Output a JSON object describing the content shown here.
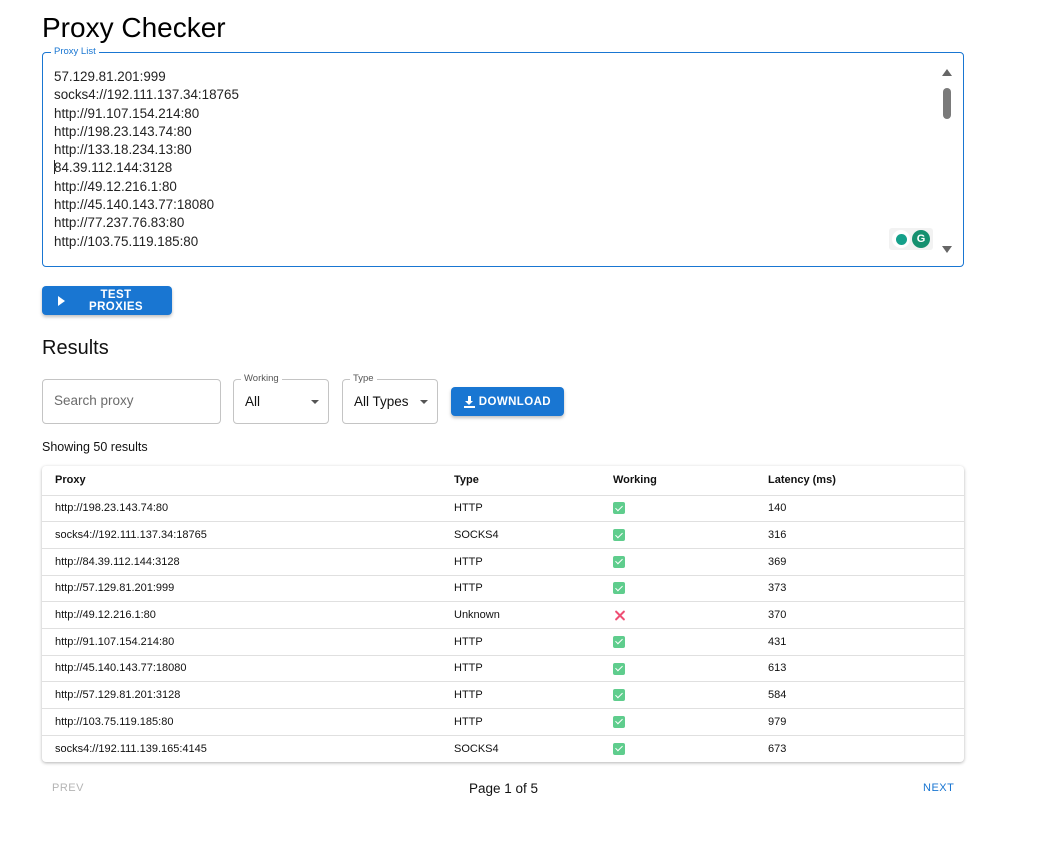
{
  "app": {
    "title": "Proxy Checker"
  },
  "proxy_list": {
    "label": "Proxy List",
    "lines": [
      "57.129.81.201:999",
      "socks4://192.111.137.34:18765",
      "http://91.107.154.214:80",
      "http://198.23.143.74:80",
      "http://133.18.234.13:80",
      "84.39.112.144:3128",
      "http://49.12.216.1:80",
      "http://45.140.143.77:18080",
      "http://77.237.76.83:80",
      "http://103.75.119.185:80"
    ],
    "caret_line": 5
  },
  "actions": {
    "test_label": "Test Proxies",
    "download_label": "Download"
  },
  "results": {
    "title": "Results",
    "search_placeholder": "Search proxy",
    "filters": {
      "working": {
        "label": "Working",
        "value": "All"
      },
      "type": {
        "label": "Type",
        "value": "All Types"
      }
    },
    "showing_text": "Showing 50 results",
    "table": {
      "headers": [
        "Proxy",
        "Type",
        "Working",
        "Latency (ms)"
      ],
      "rows": [
        {
          "proxy": "http://198.23.143.74:80",
          "type": "HTTP",
          "working": true,
          "latency": "140"
        },
        {
          "proxy": "socks4://192.111.137.34:18765",
          "type": "SOCKS4",
          "working": true,
          "latency": "316"
        },
        {
          "proxy": "http://84.39.112.144:3128",
          "type": "HTTP",
          "working": true,
          "latency": "369"
        },
        {
          "proxy": "http://57.129.81.201:999",
          "type": "HTTP",
          "working": true,
          "latency": "373"
        },
        {
          "proxy": "http://49.12.216.1:80",
          "type": "Unknown",
          "working": false,
          "latency": "370"
        },
        {
          "proxy": "http://91.107.154.214:80",
          "type": "HTTP",
          "working": true,
          "latency": "431"
        },
        {
          "proxy": "http://45.140.143.77:18080",
          "type": "HTTP",
          "working": true,
          "latency": "613"
        },
        {
          "proxy": "http://57.129.81.201:3128",
          "type": "HTTP",
          "working": true,
          "latency": "584"
        },
        {
          "proxy": "http://103.75.119.185:80",
          "type": "HTTP",
          "working": true,
          "latency": "979"
        },
        {
          "proxy": "socks4://192.111.139.165:4145",
          "type": "SOCKS4",
          "working": true,
          "latency": "673"
        }
      ]
    }
  },
  "pagination": {
    "prev_label": "PREV",
    "page_text": "Page 1 of 5",
    "next_label": "NEXT"
  },
  "colors": {
    "primary": "#1976d2",
    "success": "#5fcd8d",
    "error": "#ef4f74",
    "disabled": "#b4b4b4"
  },
  "icons": {
    "test_button": "play-icon",
    "download_button": "download-icon",
    "working_true": "check-box-icon",
    "working_false": "close-icon"
  }
}
